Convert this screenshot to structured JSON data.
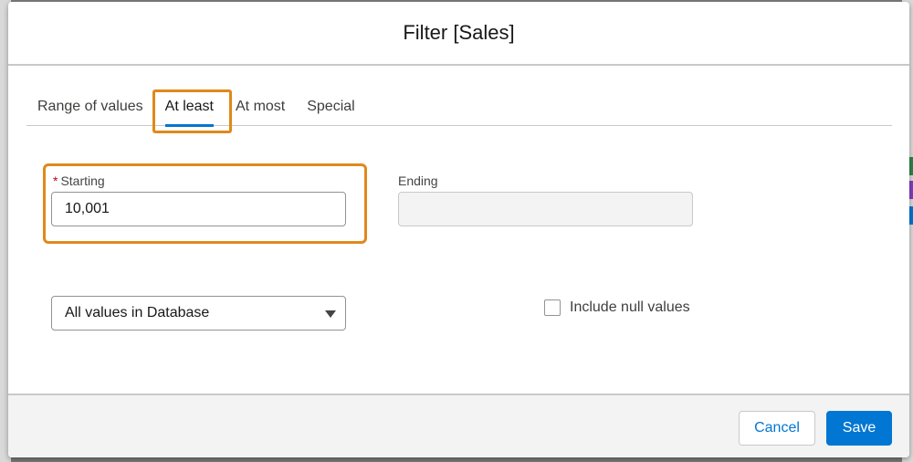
{
  "modal": {
    "title": "Filter [Sales]"
  },
  "tabs": [
    {
      "label": "Range of values",
      "active": false
    },
    {
      "label": "At least",
      "active": true
    },
    {
      "label": "At most",
      "active": false
    },
    {
      "label": "Special",
      "active": false
    }
  ],
  "starting": {
    "required_mark": "*",
    "label": "Starting",
    "value": "10,001"
  },
  "ending": {
    "label": "Ending",
    "value": ""
  },
  "values_select": {
    "selected": "All values in Database"
  },
  "include_null": {
    "label": "Include null values",
    "checked": false
  },
  "footer": {
    "cancel_label": "Cancel",
    "save_label": "Save"
  },
  "colors": {
    "accent": "#0176d3",
    "highlight": "#e0891b",
    "required": "#ba0517"
  }
}
